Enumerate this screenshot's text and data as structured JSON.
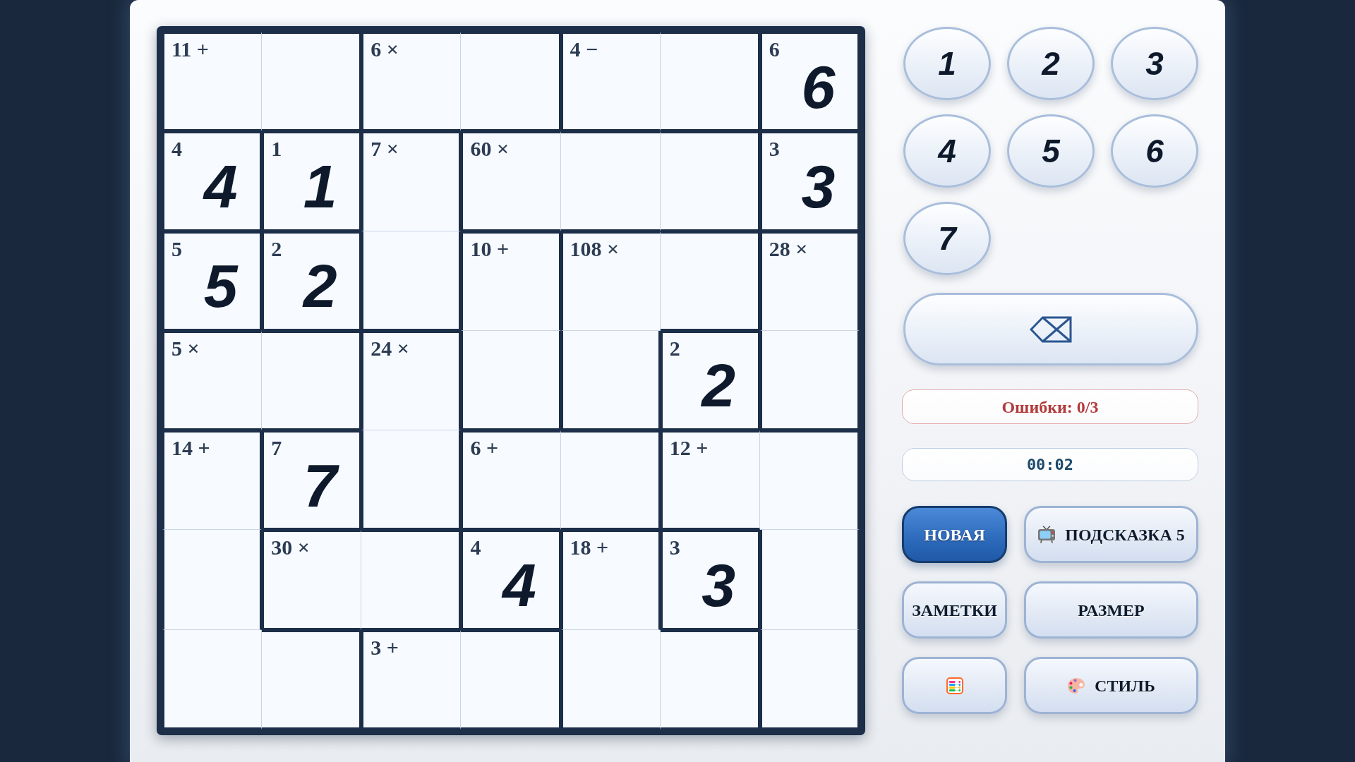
{
  "board": {
    "rows": [
      [
        {
          "clue": "11 +",
          "wall_right": false,
          "wall_bottom": true
        },
        {
          "wall_right": true,
          "wall_bottom": true
        },
        {
          "clue": "6 ×",
          "wall_right": false,
          "wall_bottom": true
        },
        {
          "wall_right": true,
          "wall_bottom": true
        },
        {
          "clue": "4 −",
          "wall_right": false,
          "wall_bottom": true
        },
        {
          "wall_right": true,
          "wall_bottom": true
        },
        {
          "clue": "6",
          "value": "6",
          "wall_right": true,
          "wall_bottom": true
        }
      ],
      [
        {
          "clue": "4",
          "value": "4",
          "wall_right": true,
          "wall_bottom": true
        },
        {
          "clue": "1",
          "value": "1",
          "wall_right": true,
          "wall_bottom": true
        },
        {
          "clue": "7 ×",
          "wall_right": true,
          "wall_bottom": false
        },
        {
          "clue": "60 ×",
          "wall_right": false,
          "wall_bottom": true
        },
        {
          "wall_right": false,
          "wall_bottom": true
        },
        {
          "wall_right": true,
          "wall_bottom": true
        },
        {
          "clue": "3",
          "value": "3",
          "wall_right": true,
          "wall_bottom": true
        }
      ],
      [
        {
          "clue": "5",
          "value": "5",
          "wall_right": true,
          "wall_bottom": true
        },
        {
          "clue": "2",
          "value": "2",
          "wall_right": true,
          "wall_bottom": true
        },
        {
          "wall_right": true,
          "wall_bottom": true
        },
        {
          "clue": "10 +",
          "wall_right": true,
          "wall_bottom": false
        },
        {
          "clue": "108 ×",
          "wall_right": false,
          "wall_bottom": false
        },
        {
          "wall_right": true,
          "wall_bottom": true
        },
        {
          "clue": "28 ×",
          "wall_right": true,
          "wall_bottom": false
        }
      ],
      [
        {
          "clue": "5 ×",
          "wall_right": false,
          "wall_bottom": true
        },
        {
          "wall_right": true,
          "wall_bottom": true
        },
        {
          "clue": "24 ×",
          "wall_right": true,
          "wall_bottom": false
        },
        {
          "wall_right": true,
          "wall_bottom": true
        },
        {
          "wall_right": true,
          "wall_bottom": true
        },
        {
          "clue": "2",
          "value": "2",
          "wall_right": true,
          "wall_bottom": true
        },
        {
          "wall_right": true,
          "wall_bottom": true
        }
      ],
      [
        {
          "clue": "14 +",
          "wall_right": true,
          "wall_bottom": false
        },
        {
          "clue": "7",
          "value": "7",
          "wall_right": true,
          "wall_bottom": true
        },
        {
          "wall_right": true,
          "wall_bottom": true
        },
        {
          "clue": "6 +",
          "wall_right": false,
          "wall_bottom": true
        },
        {
          "wall_right": true,
          "wall_bottom": true
        },
        {
          "clue": "12 +",
          "wall_right": false,
          "wall_bottom": true
        },
        {
          "wall_right": true,
          "wall_bottom": false
        }
      ],
      [
        {
          "wall_right": true,
          "wall_bottom": false
        },
        {
          "clue": "30 ×",
          "wall_right": false,
          "wall_bottom": true
        },
        {
          "wall_right": true,
          "wall_bottom": true
        },
        {
          "clue": "4",
          "value": "4",
          "wall_right": true,
          "wall_bottom": true
        },
        {
          "clue": "18 +",
          "wall_right": true,
          "wall_bottom": false
        },
        {
          "clue": "3",
          "value": "3",
          "wall_right": true,
          "wall_bottom": true
        },
        {
          "wall_right": true,
          "wall_bottom": false
        }
      ],
      [
        {
          "wall_right": false,
          "wall_bottom": true
        },
        {
          "wall_right": true,
          "wall_bottom": true
        },
        {
          "clue": "3 +",
          "wall_right": false,
          "wall_bottom": true
        },
        {
          "wall_right": true,
          "wall_bottom": true
        },
        {
          "wall_right": false,
          "wall_bottom": true
        },
        {
          "wall_right": true,
          "wall_bottom": true
        },
        {
          "wall_right": true,
          "wall_bottom": true
        }
      ]
    ]
  },
  "keypad": {
    "keys": [
      "1",
      "2",
      "3",
      "4",
      "5",
      "6",
      "7"
    ]
  },
  "mistakes": "Ошибки: 0/3",
  "timer": "00:02",
  "buttons": {
    "new_game": "НОВАЯ",
    "hint": "ПОДСКАЗКА 5",
    "notes": "ЗАМЕТКИ",
    "size": "РАЗМЕР",
    "style": "СТИЛЬ"
  }
}
